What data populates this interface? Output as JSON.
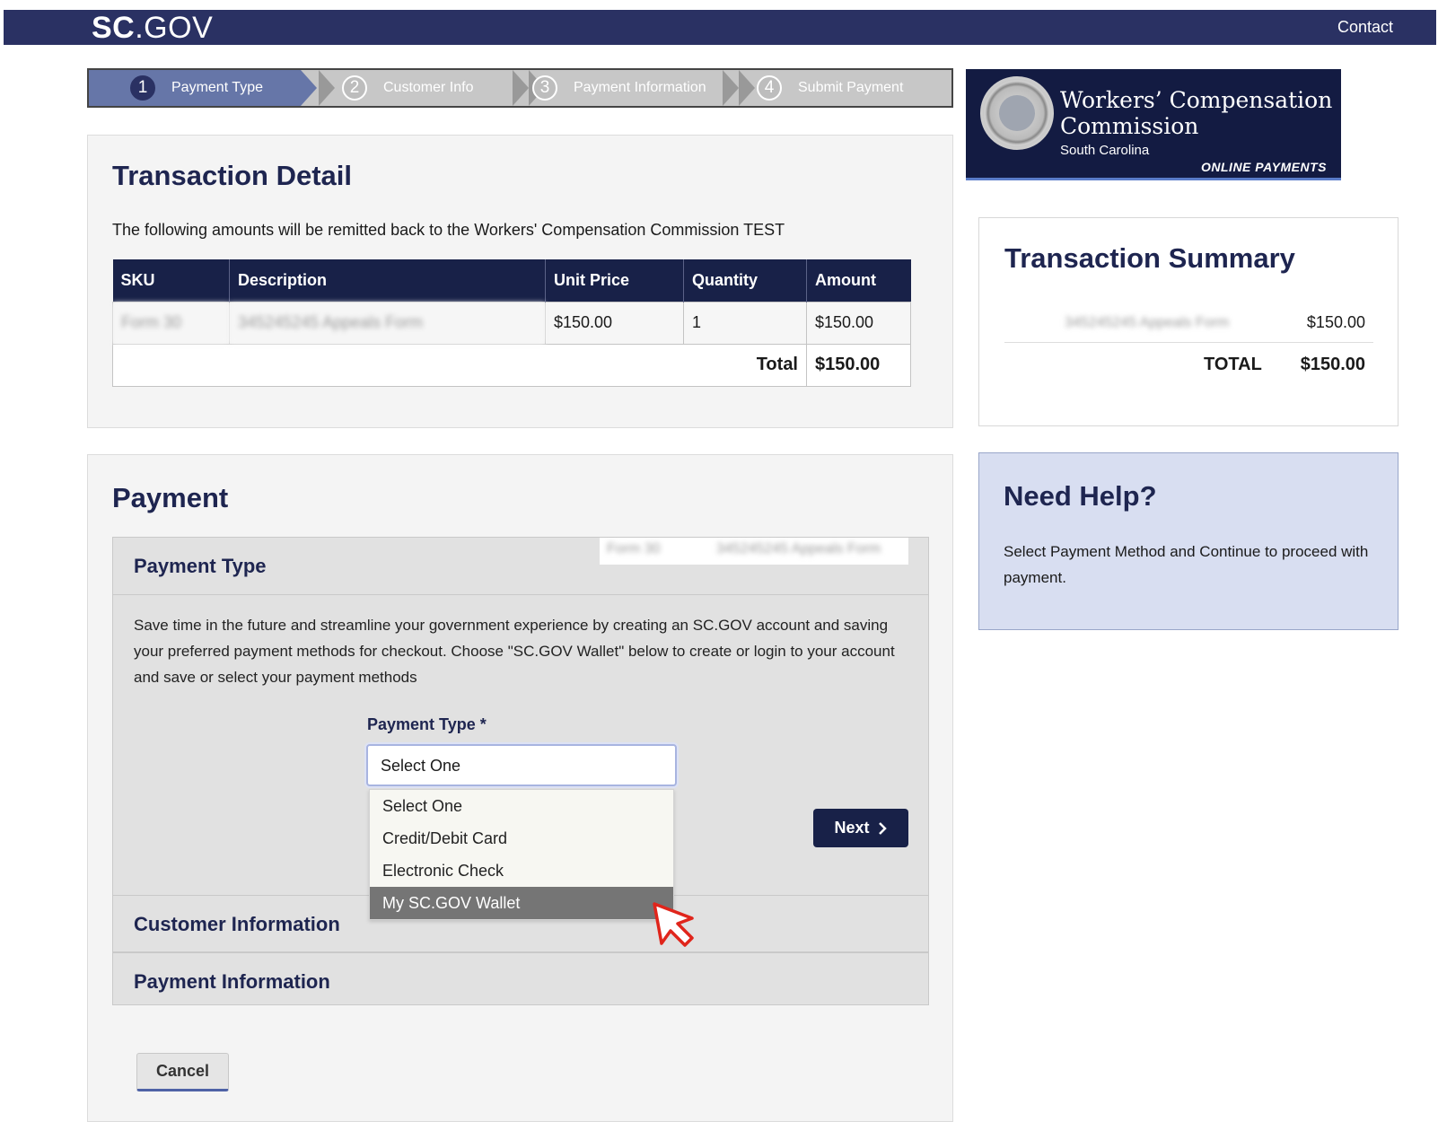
{
  "header": {
    "logo_bold": "SC",
    "logo_light": ".GOV",
    "contact_label": "Contact"
  },
  "stepper": {
    "steps": [
      {
        "num": "1",
        "label": "Payment Type"
      },
      {
        "num": "2",
        "label": "Customer Info"
      },
      {
        "num": "3",
        "label": "Payment Information"
      },
      {
        "num": "4",
        "label": "Submit Payment"
      }
    ]
  },
  "brand": {
    "title_line1": "Workers’ Compensation",
    "title_line2": "Commission",
    "subtitle": "South Carolina",
    "tagline": "ONLINE PAYMENTS"
  },
  "transaction_detail": {
    "title": "Transaction Detail",
    "description": "The following amounts will be remitted back to the Workers' Compensation Commission TEST",
    "columns": [
      "SKU",
      "Description",
      "Unit Price",
      "Quantity",
      "Amount"
    ],
    "rows": [
      {
        "sku": "Form 30",
        "description": "345245245 Appeals Form",
        "unit_price": "$150.00",
        "quantity": "1",
        "amount": "$150.00"
      }
    ],
    "total_label": "Total",
    "total_value": "$150.00"
  },
  "summary": {
    "title": "Transaction Summary",
    "item_name": "345245245 Appeals Form",
    "item_amount": "$150.00",
    "total_label": "TOTAL",
    "total_value": "$150.00"
  },
  "help": {
    "title": "Need Help?",
    "text": "Select Payment Method and Continue to proceed with payment."
  },
  "payment": {
    "title": "Payment",
    "sections": {
      "payment_type": "Payment Type",
      "customer_info": "Customer Information",
      "payment_info": "Payment Information"
    },
    "overlay_sku": "Form 30",
    "overlay_desc": "345245245 Appeals Form",
    "info_text": "Save time in the future and streamline your government experience by creating an SC.GOV account and saving your preferred payment methods for checkout. Choose \"SC.GOV Wallet\" below to create or login to your account and save or select your payment methods",
    "field_label": "Payment Type *",
    "selected_value": "Select One",
    "options": [
      "Select One",
      "Credit/Debit Card",
      "Electronic Check",
      "My SC.GOV Wallet"
    ],
    "highlighted_option": "My SC.GOV Wallet",
    "next_label": "Next",
    "cancel_label": "Cancel"
  },
  "colors": {
    "nav": "#2a3163",
    "primary_dark": "#182148",
    "help_bg": "#d8def1"
  }
}
